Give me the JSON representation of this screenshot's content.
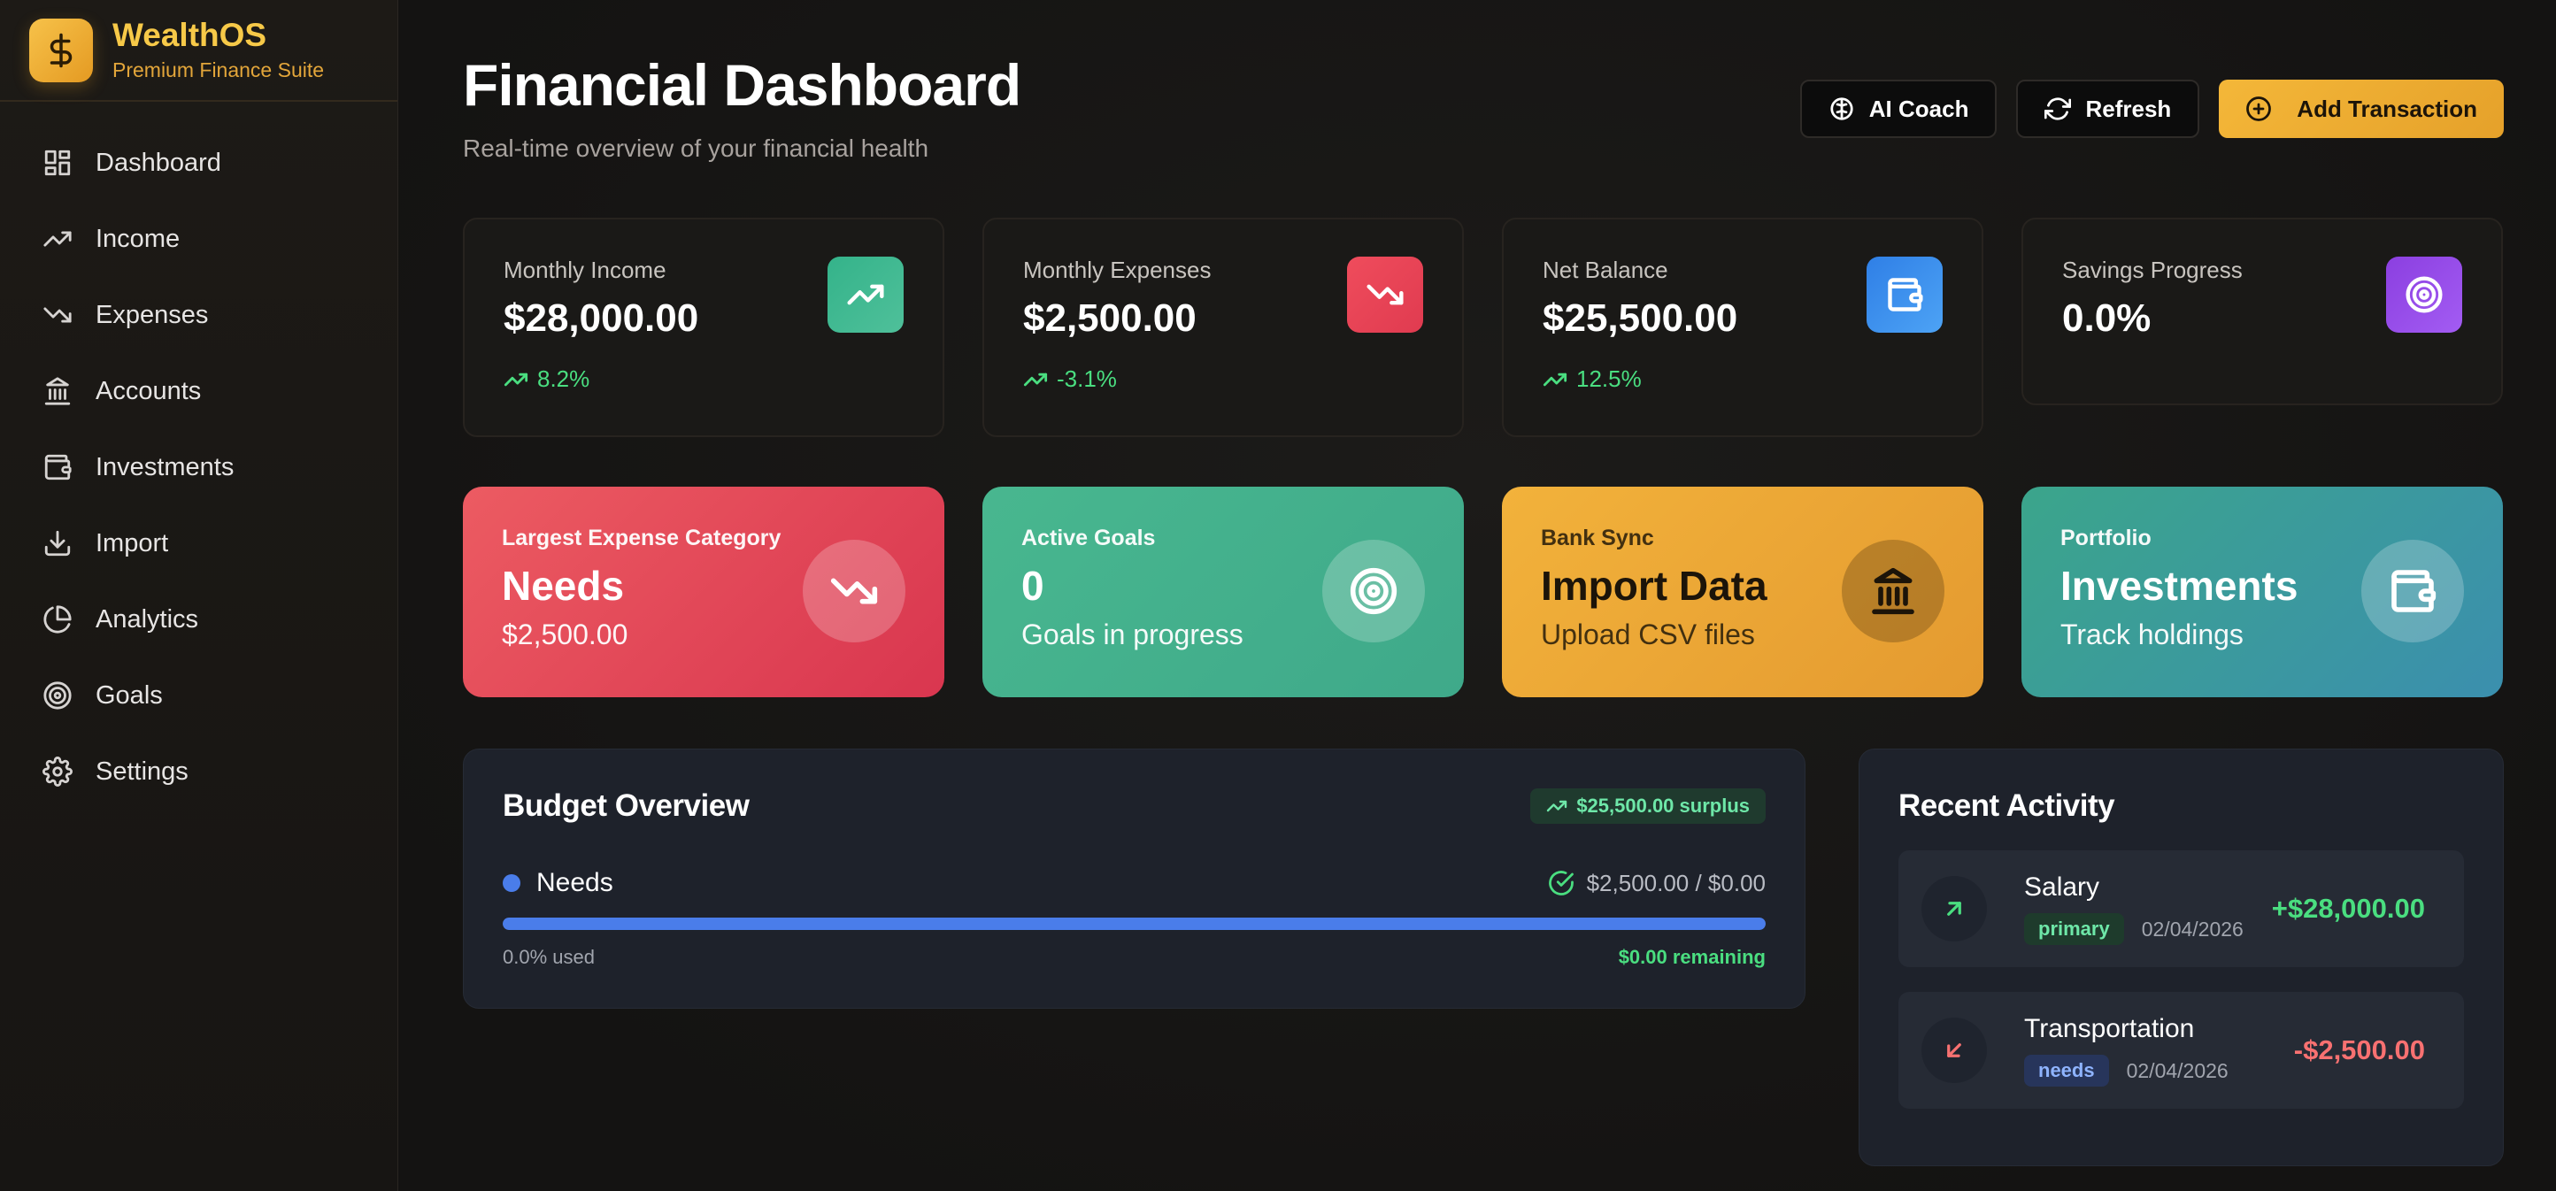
{
  "brand": {
    "name": "WealthOS",
    "tagline": "Premium Finance Suite",
    "logo_icon": "dollar-icon"
  },
  "sidebar": {
    "items": [
      {
        "label": "Dashboard",
        "icon": "grid-icon"
      },
      {
        "label": "Income",
        "icon": "trend-up-icon"
      },
      {
        "label": "Expenses",
        "icon": "trend-down-icon"
      },
      {
        "label": "Accounts",
        "icon": "bank-icon"
      },
      {
        "label": "Investments",
        "icon": "wallet-icon"
      },
      {
        "label": "Import",
        "icon": "download-icon"
      },
      {
        "label": "Analytics",
        "icon": "pie-chart-icon"
      },
      {
        "label": "Goals",
        "icon": "target-icon"
      },
      {
        "label": "Settings",
        "icon": "gear-icon"
      }
    ]
  },
  "header": {
    "title": "Financial Dashboard",
    "subtitle": "Real-time overview of your financial health",
    "ai_coach_label": "AI Coach",
    "refresh_label": "Refresh",
    "add_transaction_label": "Add Transaction"
  },
  "stats": [
    {
      "label": "Monthly Income",
      "value": "$28,000.00",
      "delta": "8.2%",
      "icon": "trend-up-icon",
      "color": "#34b38a"
    },
    {
      "label": "Monthly Expenses",
      "value": "$2,500.00",
      "delta": "-3.1%",
      "icon": "trend-down-icon",
      "color": "#ef4c5c"
    },
    {
      "label": "Net Balance",
      "value": "$25,500.00",
      "delta": "12.5%",
      "icon": "wallet-icon",
      "color": "#2f7fe6"
    },
    {
      "label": "Savings Progress",
      "value": "0.0%",
      "icon": "target-icon",
      "color": "#8b3fe0"
    }
  ],
  "features": [
    {
      "eyebrow": "Largest Expense Category",
      "title": "Needs",
      "subtitle": "$2,500.00",
      "icon": "trend-down-icon"
    },
    {
      "eyebrow": "Active Goals",
      "title": "0",
      "subtitle": "Goals in progress",
      "icon": "target-icon"
    },
    {
      "eyebrow": "Bank Sync",
      "title": "Import Data",
      "subtitle": "Upload CSV files",
      "icon": "bank-icon"
    },
    {
      "eyebrow": "Portfolio",
      "title": "Investments",
      "subtitle": "Track holdings",
      "icon": "wallet-icon"
    }
  ],
  "budget": {
    "title": "Budget Overview",
    "surplus": "$25,500.00 surplus",
    "items": [
      {
        "name": "Needs",
        "amount": "$2,500.00 / $0.00",
        "used": "0.0% used",
        "remaining": "$0.00 remaining",
        "progress": 1.0,
        "color": "#4a7dea"
      }
    ]
  },
  "activity": {
    "title": "Recent Activity",
    "items": [
      {
        "name": "Salary",
        "tag": "primary",
        "date": "02/04/2026",
        "amount": "+$28,000.00",
        "direction": "in",
        "icon": "arrow-up-right-icon"
      },
      {
        "name": "Transportation",
        "tag": "needs",
        "date": "02/04/2026",
        "amount": "-$2,500.00",
        "direction": "out",
        "icon": "arrow-down-left-icon"
      }
    ]
  }
}
